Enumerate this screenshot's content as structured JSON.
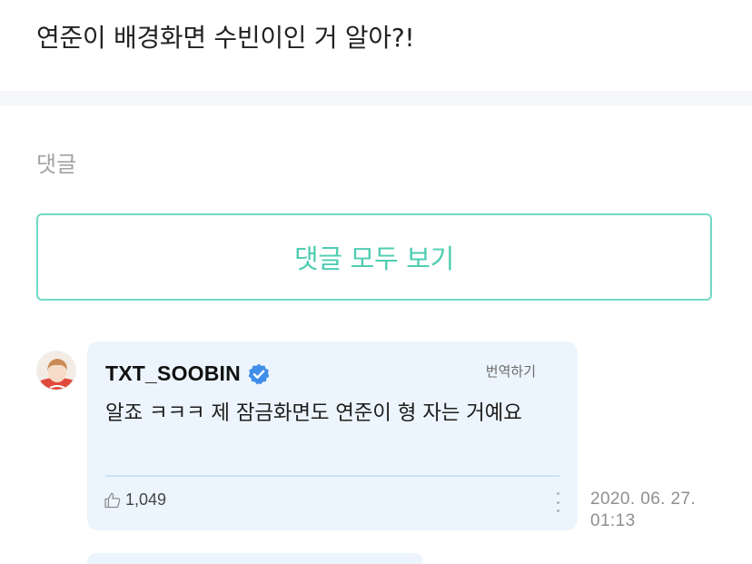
{
  "post": {
    "title": "연준이 배경화면 수빈이인 거 알아?!"
  },
  "comments_section": {
    "label": "댓글",
    "view_all_button": "댓글 모두 보기"
  },
  "comment": {
    "author": "TXT_SOOBIN",
    "verified": true,
    "translate_label": "번역하기",
    "body": "알죠 ㅋㅋㅋ 제 잠금화면도 연준이 형 자는 거예요",
    "like_count": "1,049",
    "timestamp_line1": "2020. 06. 27.",
    "timestamp_line2": "01:13"
  },
  "colors": {
    "accent": "#4fcdb2",
    "bubble_bg": "#ecf5fd",
    "verified_badge": "#3f8ee9"
  },
  "icons": [
    "verified-badge-icon",
    "thumbs-up-icon",
    "more-vertical-icon"
  ]
}
